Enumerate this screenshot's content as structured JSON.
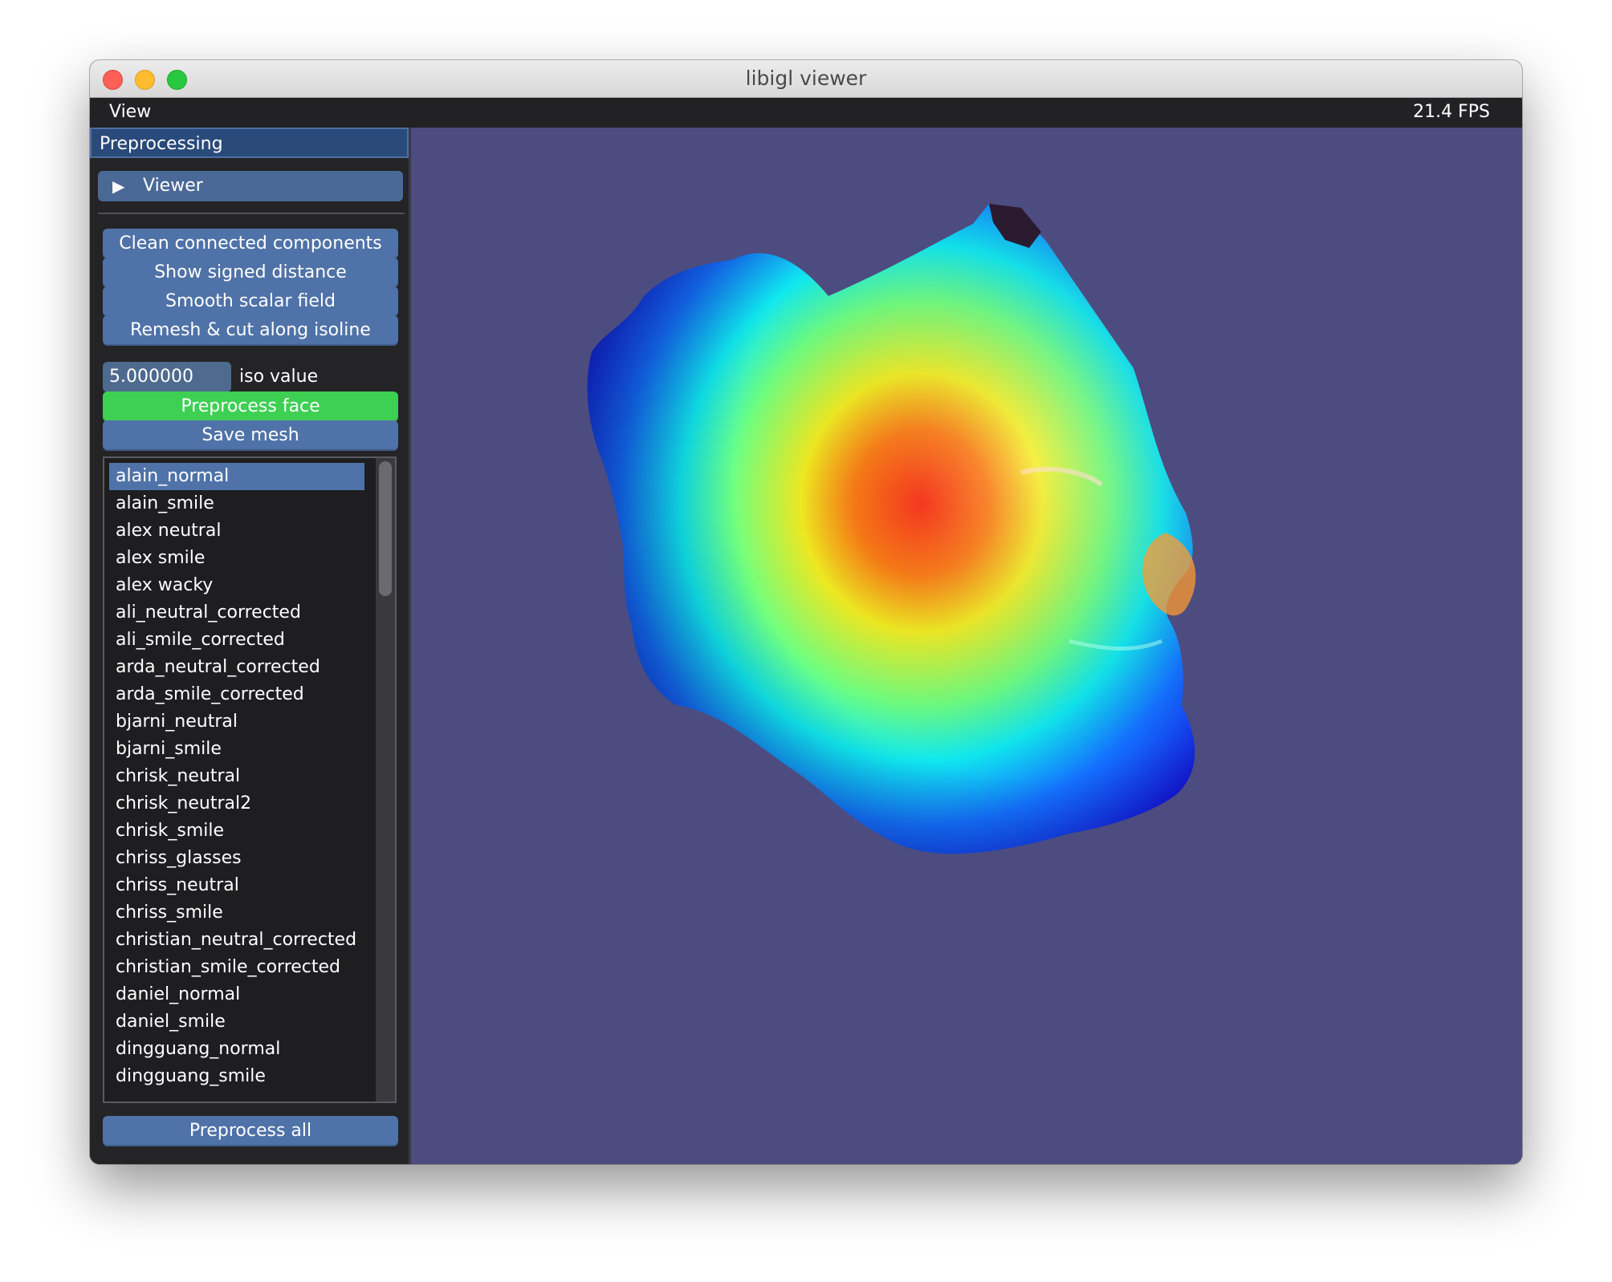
{
  "window": {
    "title": "libigl viewer"
  },
  "menubar": {
    "view_label": "View",
    "fps": "21.4 FPS"
  },
  "panel": {
    "header": "Preprocessing",
    "viewer_section": "Viewer",
    "buttons": {
      "clean": "Clean connected components",
      "signed": "Show signed distance",
      "smooth": "Smooth scalar field",
      "remesh": "Remesh & cut along isoline",
      "preprocess_face": "Preprocess face",
      "save": "Save mesh",
      "preprocess_all": "Preprocess all"
    },
    "iso": {
      "value": "5.000000",
      "label": "iso value"
    },
    "files": [
      "alain_normal",
      "alain_smile",
      "alex neutral",
      "alex smile",
      "alex wacky",
      "ali_neutral_corrected",
      "ali_smile_corrected",
      "arda_neutral_corrected",
      "arda_smile_corrected",
      "bjarni_neutral",
      "bjarni_smile",
      "chrisk_neutral",
      "chrisk_neutral2",
      "chrisk_smile",
      "chriss_glasses",
      "chriss_neutral",
      "chriss_smile",
      "christian_neutral_corrected",
      "christian_smile_corrected",
      "daniel_normal",
      "daniel_smile",
      "dingguang_normal",
      "dingguang_smile"
    ],
    "selected_index": 0
  },
  "colors": {
    "viewport_bg": "#4c4c80",
    "accent_blue": "#4f72a8",
    "accent_green": "#3ed053"
  }
}
